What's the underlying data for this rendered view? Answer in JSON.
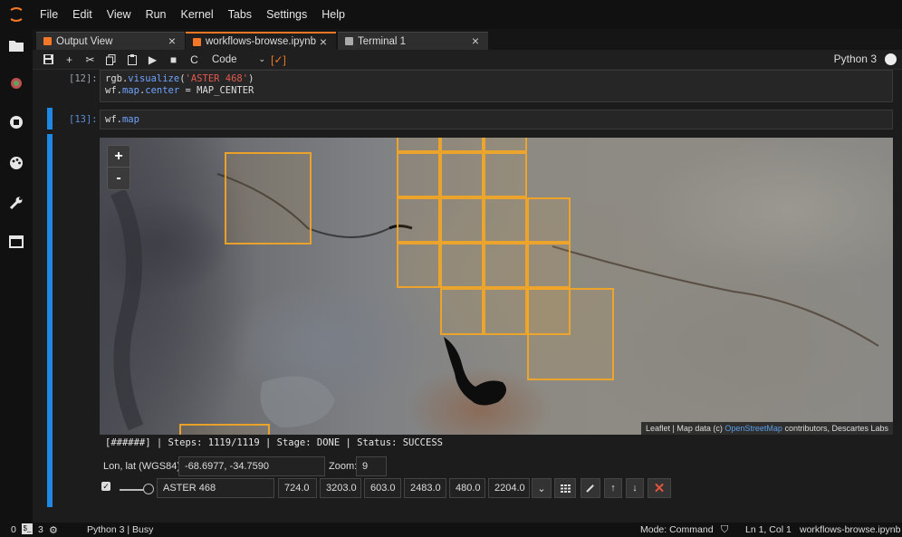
{
  "menubar": {
    "items": [
      "File",
      "Edit",
      "View",
      "Run",
      "Kernel",
      "Tabs",
      "Settings",
      "Help"
    ]
  },
  "tabs": [
    {
      "label": "Output View",
      "icon": "notebook-icon"
    },
    {
      "label": "workflows-browse.ipynb",
      "icon": "notebook-icon",
      "active": true
    },
    {
      "label": "Terminal 1",
      "icon": "terminal-icon"
    }
  ],
  "toolbar": {
    "cell_type": "Code",
    "kernel": "Python 3"
  },
  "cells": {
    "cell12": {
      "prompt": "[12]:",
      "line1_a": "rgb.",
      "line1_b": "visualize",
      "line1_c": "(",
      "line1_d": "'ASTER 468'",
      "line1_e": ")",
      "line2_a": "wf.",
      "line2_b": "map",
      "line2_c": ".",
      "line2_d": "center",
      "line2_e": " = MAP_CENTER"
    },
    "cell13": {
      "prompt": "[13]:",
      "code_a": "wf.",
      "code_b": "map"
    }
  },
  "map": {
    "zoom_in": "+",
    "zoom_out": "-",
    "attribution_pre": "Leaflet | Map data (c) ",
    "attribution_link": "OpenStreetMap",
    "attribution_post": " contributors, Descartes Labs"
  },
  "progress": "[######] | Steps: 1119/1119 | Stage: DONE | Status: SUCCESS",
  "coords": {
    "label": "Lon, lat (WGS84):",
    "value": "-68.6977, -34.7590",
    "zoom_label": "Zoom:",
    "zoom_value": "9"
  },
  "layer": {
    "checked": true,
    "name": "ASTER 468",
    "values": [
      "724.0",
      "3203.0",
      "603.0",
      "2483.0",
      "480.0",
      "2204.0"
    ]
  },
  "statusbar": {
    "terminals": "0",
    "kernels": "3",
    "kernel_status": "Python 3 | Busy",
    "mode": "Mode: Command",
    "cursor": "Ln 1, Col 1",
    "file": "workflows-browse.ipynb"
  },
  "colors": {
    "accent": "#f37726",
    "tile_border": "#f5a623",
    "active_cell": "#1e88e5",
    "close_button": "#e0533c"
  }
}
